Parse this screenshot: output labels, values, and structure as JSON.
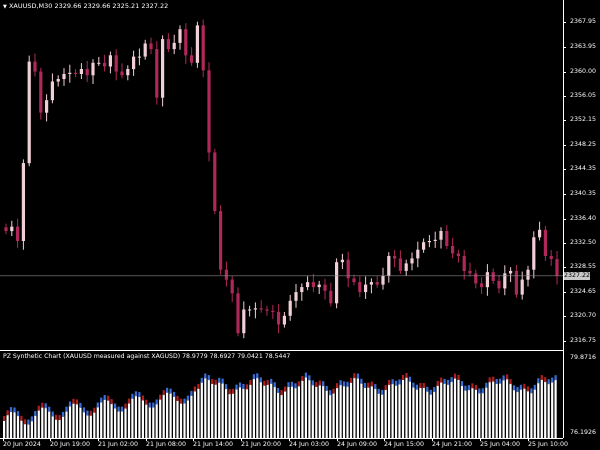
{
  "header": {
    "dropdown_icon": "triangle-down-icon",
    "symbol": "XAUUSD,M30",
    "ohlc": "2329.66 2329.66 2325.21 2327.22"
  },
  "price_axis": {
    "labels": [
      "2367.95",
      "2363.95",
      "2360.00",
      "2356.05",
      "2352.15",
      "2348.25",
      "2344.35",
      "2340.35",
      "2336.40",
      "2332.50",
      "2328.55",
      "2324.65",
      "2320.70",
      "2316.75"
    ],
    "current_price": "2327.22"
  },
  "indicator": {
    "title": "PZ Synthetic Chart (XAUUSD measured against XAGUSD) 78.9779 78.6927 79.0421 78.5447",
    "axis_top": "79.8716",
    "axis_bottom": "76.1926"
  },
  "time_axis": {
    "labels": [
      "20 Jun 2024",
      "20 Jun 19:00",
      "21 Jun 02:00",
      "21 Jun 08:00",
      "21 Jun 14:00",
      "21 Jun 20:00",
      "24 Jun 03:00",
      "24 Jun 09:00",
      "24 Jun 15:00",
      "24 Jun 21:00",
      "25 Jun 04:00",
      "25 Jun 10:00"
    ]
  },
  "colors": {
    "background": "#000000",
    "bull_candle": "#f0cfd7",
    "bear_candle": "#b0285a",
    "ind_bar": "#ffffff",
    "ind_up_tip": "#3a6fd8",
    "ind_down_tip": "#b02020",
    "grid": "#ffffff"
  },
  "chart_data": {
    "type": "candlestick",
    "symbol": "XAUUSD,M30",
    "ylim": [
      2315.5,
      2370.5
    ],
    "candles_close": [
      2334.4,
      2335.1,
      2332.8,
      2345.3,
      2361.6,
      2360.0,
      2353.4,
      2355.4,
      2358.4,
      2358.8,
      2359.6,
      2359.8,
      2359.6,
      2360.4,
      2359.4,
      2361.4,
      2361.4,
      2360.8,
      2362.6,
      2360.0,
      2359.4,
      2360.4,
      2362.4,
      2362.4,
      2364.5,
      2363.6,
      2355.8,
      2365.2,
      2363.6,
      2364.6,
      2366.8,
      2362.6,
      2361.4,
      2367.4,
      2360.2,
      2347.0,
      2337.6,
      2328.2,
      2326.6,
      2324.4,
      2318.0,
      2321.8,
      2321.8,
      2322.0,
      2321.8,
      2321.6,
      2321.4,
      2319.4,
      2320.8,
      2323.2,
      2324.6,
      2325.4,
      2326.2,
      2325.4,
      2325.8,
      2324.8,
      2322.8,
      2329.4,
      2329.8,
      2326.8,
      2326.2,
      2324.6,
      2325.8,
      2326.2,
      2325.8,
      2327.2,
      2330.4,
      2330.0,
      2328.0,
      2329.2,
      2330.0,
      2331.4,
      2332.6,
      2332.8,
      2333.0,
      2334.4,
      2332.0,
      2330.8,
      2330.4,
      2328.0,
      2327.6,
      2326.0,
      2325.4,
      2327.8,
      2326.4,
      2325.2,
      2327.6,
      2328.0,
      2324.2,
      2326.6,
      2328.2,
      2333.4,
      2334.6,
      2330.4,
      2329.9,
      2327.2
    ],
    "indicator_series": {
      "name": "PZ Synthetic Chart (XAUUSD measured against XAGUSD)",
      "last_ohlc": [
        78.9779,
        78.6927,
        79.0421,
        78.5447
      ],
      "ylim": [
        76.1926,
        79.8716
      ]
    }
  }
}
